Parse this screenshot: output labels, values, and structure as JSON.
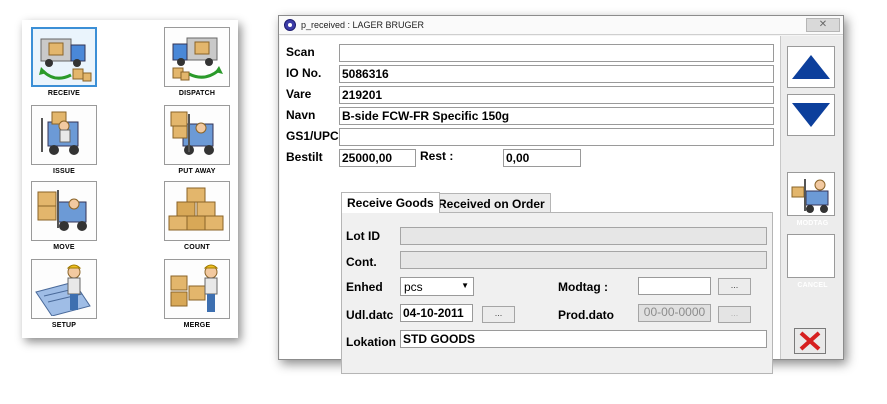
{
  "menu": {
    "items": [
      {
        "label": "RECEIVE"
      },
      {
        "label": "DISPATCH"
      },
      {
        "label": "ISSUE"
      },
      {
        "label": "PUT AWAY"
      },
      {
        "label": "MOVE"
      },
      {
        "label": "COUNT"
      },
      {
        "label": "SETUP"
      },
      {
        "label": "MERGE"
      }
    ]
  },
  "window": {
    "title": "p_received : LAGER BRUGER",
    "close_glyph": "✕"
  },
  "form": {
    "scan": {
      "label": "Scan",
      "value": ""
    },
    "io_no": {
      "label": "IO No.",
      "value": "5086316"
    },
    "vare": {
      "label": "Vare",
      "value": "219201"
    },
    "navn": {
      "label": "Navn",
      "value": "B-side FCW-FR Specific 150g"
    },
    "gs1": {
      "label": "GS1/UPC",
      "value": ""
    },
    "bestilt": {
      "label": "Bestilt",
      "value": "25000,00"
    },
    "rest": {
      "label": "Rest :",
      "value": "0,00"
    }
  },
  "tabs": [
    {
      "label": "Receive Goods",
      "active": true
    },
    {
      "label": "Received on Order",
      "active": false
    }
  ],
  "receive": {
    "lot_id": {
      "label": "Lot ID"
    },
    "cont": {
      "label": "Cont."
    },
    "enhed": {
      "label": "Enhed",
      "value": "pcs"
    },
    "modtag": {
      "label": "Modtag :",
      "value": ""
    },
    "udl_dato": {
      "label": "Udl.datc",
      "value": "04-10-2011"
    },
    "prod_dato": {
      "label": "Prod.dato",
      "value": "00-00-0000"
    },
    "lokation": {
      "label": "Lokation",
      "value": "STD GOODS"
    },
    "dots": "..."
  },
  "side": {
    "modtag_label": "MODTAG",
    "cancel_label": "CANCEL"
  },
  "colors": {
    "arrow_blue": "#0c3f9c",
    "close_red": "#d61f1f",
    "selected_border": "#3b8fd6"
  }
}
